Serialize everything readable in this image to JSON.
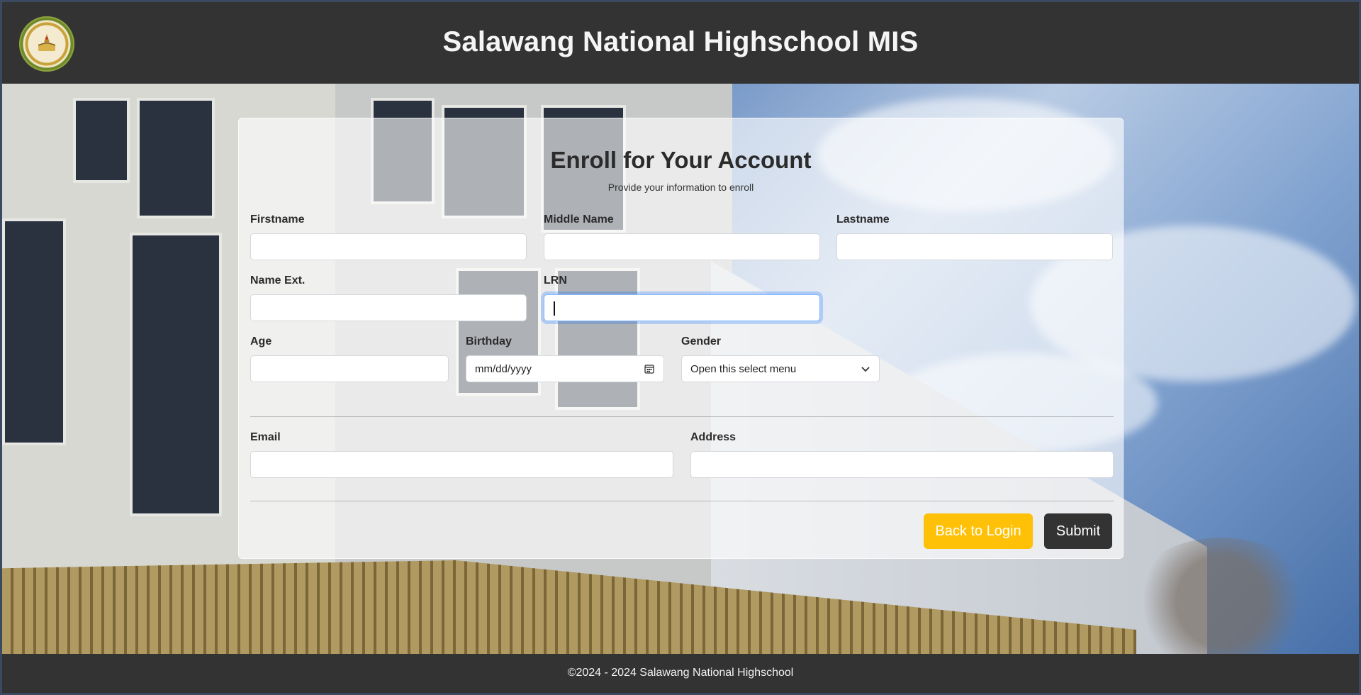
{
  "header": {
    "title": "Salawang National Highschool MIS"
  },
  "form": {
    "title": "Enroll for Your Account",
    "subtitle": "Provide your information to enroll",
    "fields": {
      "firstname": {
        "label": "Firstname",
        "value": ""
      },
      "middlename": {
        "label": "Middle Name",
        "value": ""
      },
      "lastname": {
        "label": "Lastname",
        "value": ""
      },
      "name_ext": {
        "label": "Name Ext.",
        "value": ""
      },
      "lrn": {
        "label": "LRN",
        "value": ""
      },
      "age": {
        "label": "Age",
        "value": ""
      },
      "birthday": {
        "label": "Birthday",
        "placeholder": "mm/dd/yyyy"
      },
      "gender": {
        "label": "Gender",
        "selected": "Open this select menu"
      },
      "email": {
        "label": "Email",
        "value": ""
      },
      "address": {
        "label": "Address",
        "value": ""
      }
    },
    "buttons": {
      "back": "Back to Login",
      "submit": "Submit"
    }
  },
  "footer": {
    "text": "©2024 - 2024 Salawang National Highschool"
  },
  "colors": {
    "header_bg": "#333333",
    "warning": "#ffc107",
    "dark_button": "#333333",
    "focus_ring": "#86b7fe"
  },
  "icons": {
    "logo": "school-seal-logo",
    "calendar": "calendar-icon",
    "chevron": "chevron-down-icon"
  }
}
